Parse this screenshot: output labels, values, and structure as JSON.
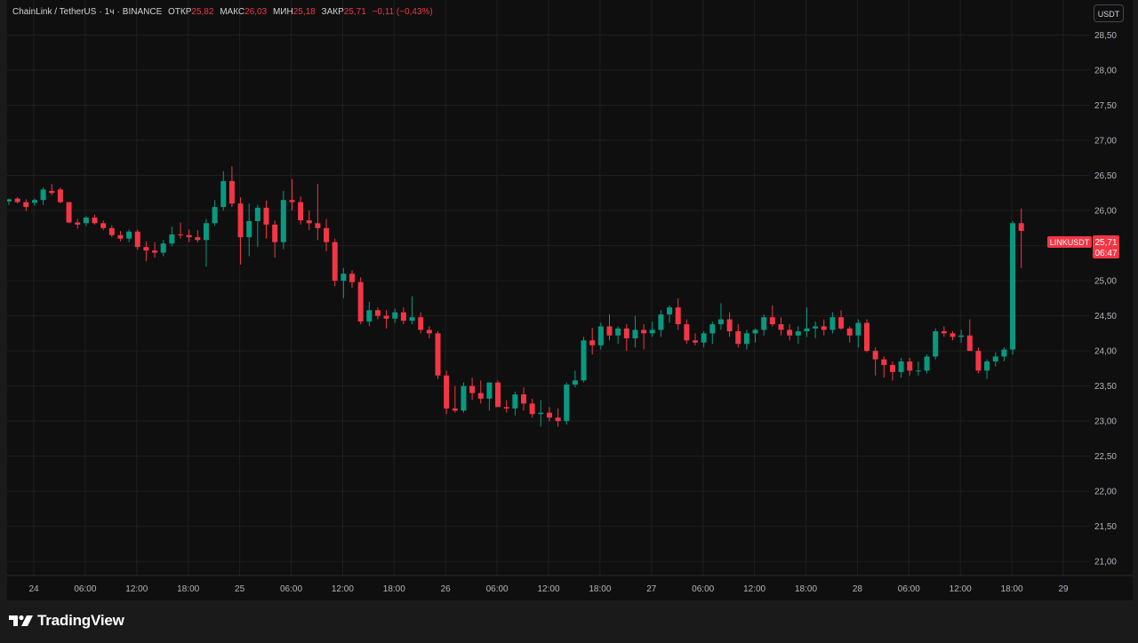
{
  "legend": {
    "symbol": "ChainLink / TetherUS",
    "interval": "1ч",
    "exchange": "BINANCE",
    "open_label": "ОТКР",
    "open_value": "25,82",
    "high_label": "МАКС",
    "high_value": "26,03",
    "low_label": "МИН",
    "low_value": "25,18",
    "close_label": "ЗАКР",
    "close_value": "25,71",
    "change": "−0,11 (−0,43%)"
  },
  "currency_button": "USDT",
  "price_tag": {
    "symbol": "LINKUSDT",
    "price": "25,71",
    "countdown": "06:47"
  },
  "branding": {
    "logo_text": "TradingView"
  },
  "colors": {
    "up": "#089981",
    "down": "#f23645",
    "background": "#0f0f0f",
    "grid": "#1f1f1f",
    "text": "#b2b5be"
  },
  "chart_data": {
    "type": "candlestick",
    "y_ticks": [
      "21,00",
      "21,50",
      "22,00",
      "22,50",
      "23,00",
      "23,50",
      "24,00",
      "24,50",
      "25,00",
      "25,50",
      "26,00",
      "26,50",
      "27,00",
      "27,50",
      "28,00",
      "28,50"
    ],
    "ylim": [
      20.8,
      29.0
    ],
    "x_ticks": [
      "24",
      "06:00",
      "12:00",
      "18:00",
      "25",
      "06:00",
      "12:00",
      "18:00",
      "26",
      "06:00",
      "12:00",
      "18:00",
      "27",
      "06:00",
      "12:00",
      "18:00",
      "28",
      "06:00",
      "12:00",
      "18:00",
      "29"
    ],
    "candles": [
      [
        26.13,
        26.17,
        26.08,
        26.16
      ],
      [
        26.17,
        26.19,
        26.1,
        26.12
      ],
      [
        26.12,
        26.16,
        25.99,
        26.05
      ],
      [
        26.11,
        26.17,
        26.07,
        26.15
      ],
      [
        26.15,
        26.33,
        26.08,
        26.3
      ],
      [
        26.28,
        26.38,
        26.22,
        26.25
      ],
      [
        26.3,
        26.33,
        26.1,
        26.12
      ],
      [
        26.12,
        26.12,
        25.82,
        25.83
      ],
      [
        25.83,
        25.88,
        25.74,
        25.8
      ],
      [
        25.82,
        25.92,
        25.78,
        25.9
      ],
      [
        25.9,
        25.94,
        25.8,
        25.82
      ],
      [
        25.82,
        25.86,
        25.72,
        25.75
      ],
      [
        25.75,
        25.79,
        25.62,
        25.65
      ],
      [
        25.65,
        25.71,
        25.56,
        25.6
      ],
      [
        25.6,
        25.73,
        25.55,
        25.7
      ],
      [
        25.7,
        25.73,
        25.44,
        25.48
      ],
      [
        25.48,
        25.56,
        25.28,
        25.43
      ],
      [
        25.43,
        25.55,
        25.33,
        25.4
      ],
      [
        25.4,
        25.58,
        25.35,
        25.53
      ],
      [
        25.53,
        25.77,
        25.49,
        25.66
      ],
      [
        25.66,
        25.83,
        25.6,
        25.65
      ],
      [
        25.65,
        25.73,
        25.55,
        25.62
      ],
      [
        25.62,
        25.72,
        25.55,
        25.58
      ],
      [
        25.58,
        25.88,
        25.2,
        25.82
      ],
      [
        25.82,
        26.15,
        25.78,
        26.05
      ],
      [
        26.05,
        26.56,
        26.0,
        26.42
      ],
      [
        26.42,
        26.63,
        26.05,
        26.1
      ],
      [
        26.1,
        26.19,
        25.23,
        25.62
      ],
      [
        25.62,
        26.1,
        25.35,
        25.85
      ],
      [
        25.85,
        26.08,
        25.48,
        26.04
      ],
      [
        26.04,
        26.14,
        25.6,
        25.8
      ],
      [
        25.8,
        25.86,
        25.33,
        25.55
      ],
      [
        25.55,
        26.28,
        25.45,
        26.15
      ],
      [
        26.15,
        26.45,
        26.0,
        26.12
      ],
      [
        26.12,
        26.2,
        25.8,
        25.86
      ],
      [
        25.86,
        26.0,
        25.72,
        25.82
      ],
      [
        25.82,
        26.38,
        25.58,
        25.75
      ],
      [
        25.75,
        25.88,
        25.42,
        25.55
      ],
      [
        25.55,
        25.6,
        24.92,
        25.0
      ],
      [
        25.0,
        25.18,
        24.75,
        25.1
      ],
      [
        25.1,
        25.15,
        24.9,
        24.98
      ],
      [
        24.98,
        25.05,
        24.38,
        24.42
      ],
      [
        24.42,
        24.7,
        24.35,
        24.58
      ],
      [
        24.58,
        24.62,
        24.45,
        24.5
      ],
      [
        24.5,
        24.58,
        24.32,
        24.46
      ],
      [
        24.46,
        24.6,
        24.4,
        24.55
      ],
      [
        24.55,
        24.62,
        24.38,
        24.43
      ],
      [
        24.43,
        24.78,
        24.38,
        24.48
      ],
      [
        24.48,
        24.55,
        24.25,
        24.3
      ],
      [
        24.3,
        24.35,
        24.18,
        24.25
      ],
      [
        24.25,
        24.28,
        23.6,
        23.65
      ],
      [
        23.65,
        23.72,
        23.1,
        23.18
      ],
      [
        23.18,
        23.5,
        23.12,
        23.15
      ],
      [
        23.15,
        23.55,
        23.12,
        23.5
      ],
      [
        23.5,
        23.62,
        23.3,
        23.4
      ],
      [
        23.4,
        23.58,
        23.25,
        23.32
      ],
      [
        23.32,
        23.52,
        23.15,
        23.55
      ],
      [
        23.55,
        23.58,
        23.28,
        23.2
      ],
      [
        23.2,
        23.3,
        23.12,
        23.18
      ],
      [
        23.18,
        23.42,
        23.08,
        23.38
      ],
      [
        23.38,
        23.48,
        23.15,
        23.25
      ],
      [
        23.25,
        23.32,
        23.05,
        23.1
      ],
      [
        23.1,
        23.3,
        22.92,
        23.12
      ],
      [
        23.12,
        23.2,
        23.0,
        23.05
      ],
      [
        23.05,
        23.18,
        22.92,
        23.0
      ],
      [
        23.0,
        23.55,
        22.95,
        23.52
      ],
      [
        23.52,
        23.72,
        23.48,
        23.58
      ],
      [
        23.58,
        24.2,
        23.55,
        24.15
      ],
      [
        24.15,
        24.33,
        23.95,
        24.08
      ],
      [
        24.08,
        24.4,
        24.02,
        24.35
      ],
      [
        24.35,
        24.52,
        24.15,
        24.22
      ],
      [
        24.22,
        24.35,
        24.1,
        24.32
      ],
      [
        24.32,
        24.38,
        24.0,
        24.18
      ],
      [
        24.18,
        24.5,
        24.05,
        24.3
      ],
      [
        24.3,
        24.38,
        24.02,
        24.25
      ],
      [
        24.25,
        24.42,
        24.2,
        24.3
      ],
      [
        24.3,
        24.58,
        24.2,
        24.52
      ],
      [
        24.52,
        24.65,
        24.4,
        24.62
      ],
      [
        24.62,
        24.75,
        24.3,
        24.38
      ],
      [
        24.38,
        24.45,
        24.1,
        24.15
      ],
      [
        24.15,
        24.25,
        24.08,
        24.12
      ],
      [
        24.12,
        24.28,
        24.05,
        24.25
      ],
      [
        24.25,
        24.42,
        24.1,
        24.38
      ],
      [
        24.38,
        24.68,
        24.3,
        24.45
      ],
      [
        24.45,
        24.55,
        24.2,
        24.28
      ],
      [
        24.28,
        24.38,
        24.05,
        24.1
      ],
      [
        24.1,
        24.3,
        24.02,
        24.25
      ],
      [
        24.25,
        24.32,
        24.12,
        24.3
      ],
      [
        24.3,
        24.52,
        24.22,
        24.48
      ],
      [
        24.48,
        24.65,
        24.35,
        24.38
      ],
      [
        24.38,
        24.48,
        24.22,
        24.3
      ],
      [
        24.3,
        24.38,
        24.15,
        24.22
      ],
      [
        24.22,
        24.35,
        24.1,
        24.28
      ],
      [
        24.28,
        24.62,
        24.2,
        24.32
      ],
      [
        24.32,
        24.42,
        24.18,
        24.35
      ],
      [
        24.35,
        24.45,
        24.22,
        24.3
      ],
      [
        24.3,
        24.55,
        24.25,
        24.48
      ],
      [
        24.48,
        24.58,
        24.3,
        24.32
      ],
      [
        24.32,
        24.35,
        24.12,
        24.22
      ],
      [
        24.22,
        24.45,
        24.05,
        24.4
      ],
      [
        24.4,
        24.45,
        23.98,
        24.0
      ],
      [
        24.0,
        24.05,
        23.65,
        23.88
      ],
      [
        23.88,
        23.92,
        23.62,
        23.8
      ],
      [
        23.8,
        23.85,
        23.58,
        23.7
      ],
      [
        23.7,
        23.9,
        23.62,
        23.85
      ],
      [
        23.85,
        23.9,
        23.65,
        23.72
      ],
      [
        23.72,
        23.85,
        23.65,
        23.72
      ],
      [
        23.72,
        23.95,
        23.68,
        23.92
      ],
      [
        23.92,
        24.32,
        23.88,
        24.28
      ],
      [
        24.28,
        24.35,
        24.2,
        24.25
      ],
      [
        24.25,
        24.28,
        24.15,
        24.2
      ],
      [
        24.2,
        24.3,
        24.12,
        24.22
      ],
      [
        24.22,
        24.45,
        24.0,
        24.0
      ],
      [
        24.0,
        24.05,
        23.68,
        23.72
      ],
      [
        23.72,
        23.88,
        23.6,
        23.85
      ],
      [
        23.85,
        23.98,
        23.78,
        23.92
      ],
      [
        23.92,
        24.05,
        23.85,
        24.02
      ],
      [
        24.02,
        25.85,
        23.95,
        25.82
      ],
      [
        25.82,
        26.03,
        25.18,
        25.71
      ]
    ]
  }
}
